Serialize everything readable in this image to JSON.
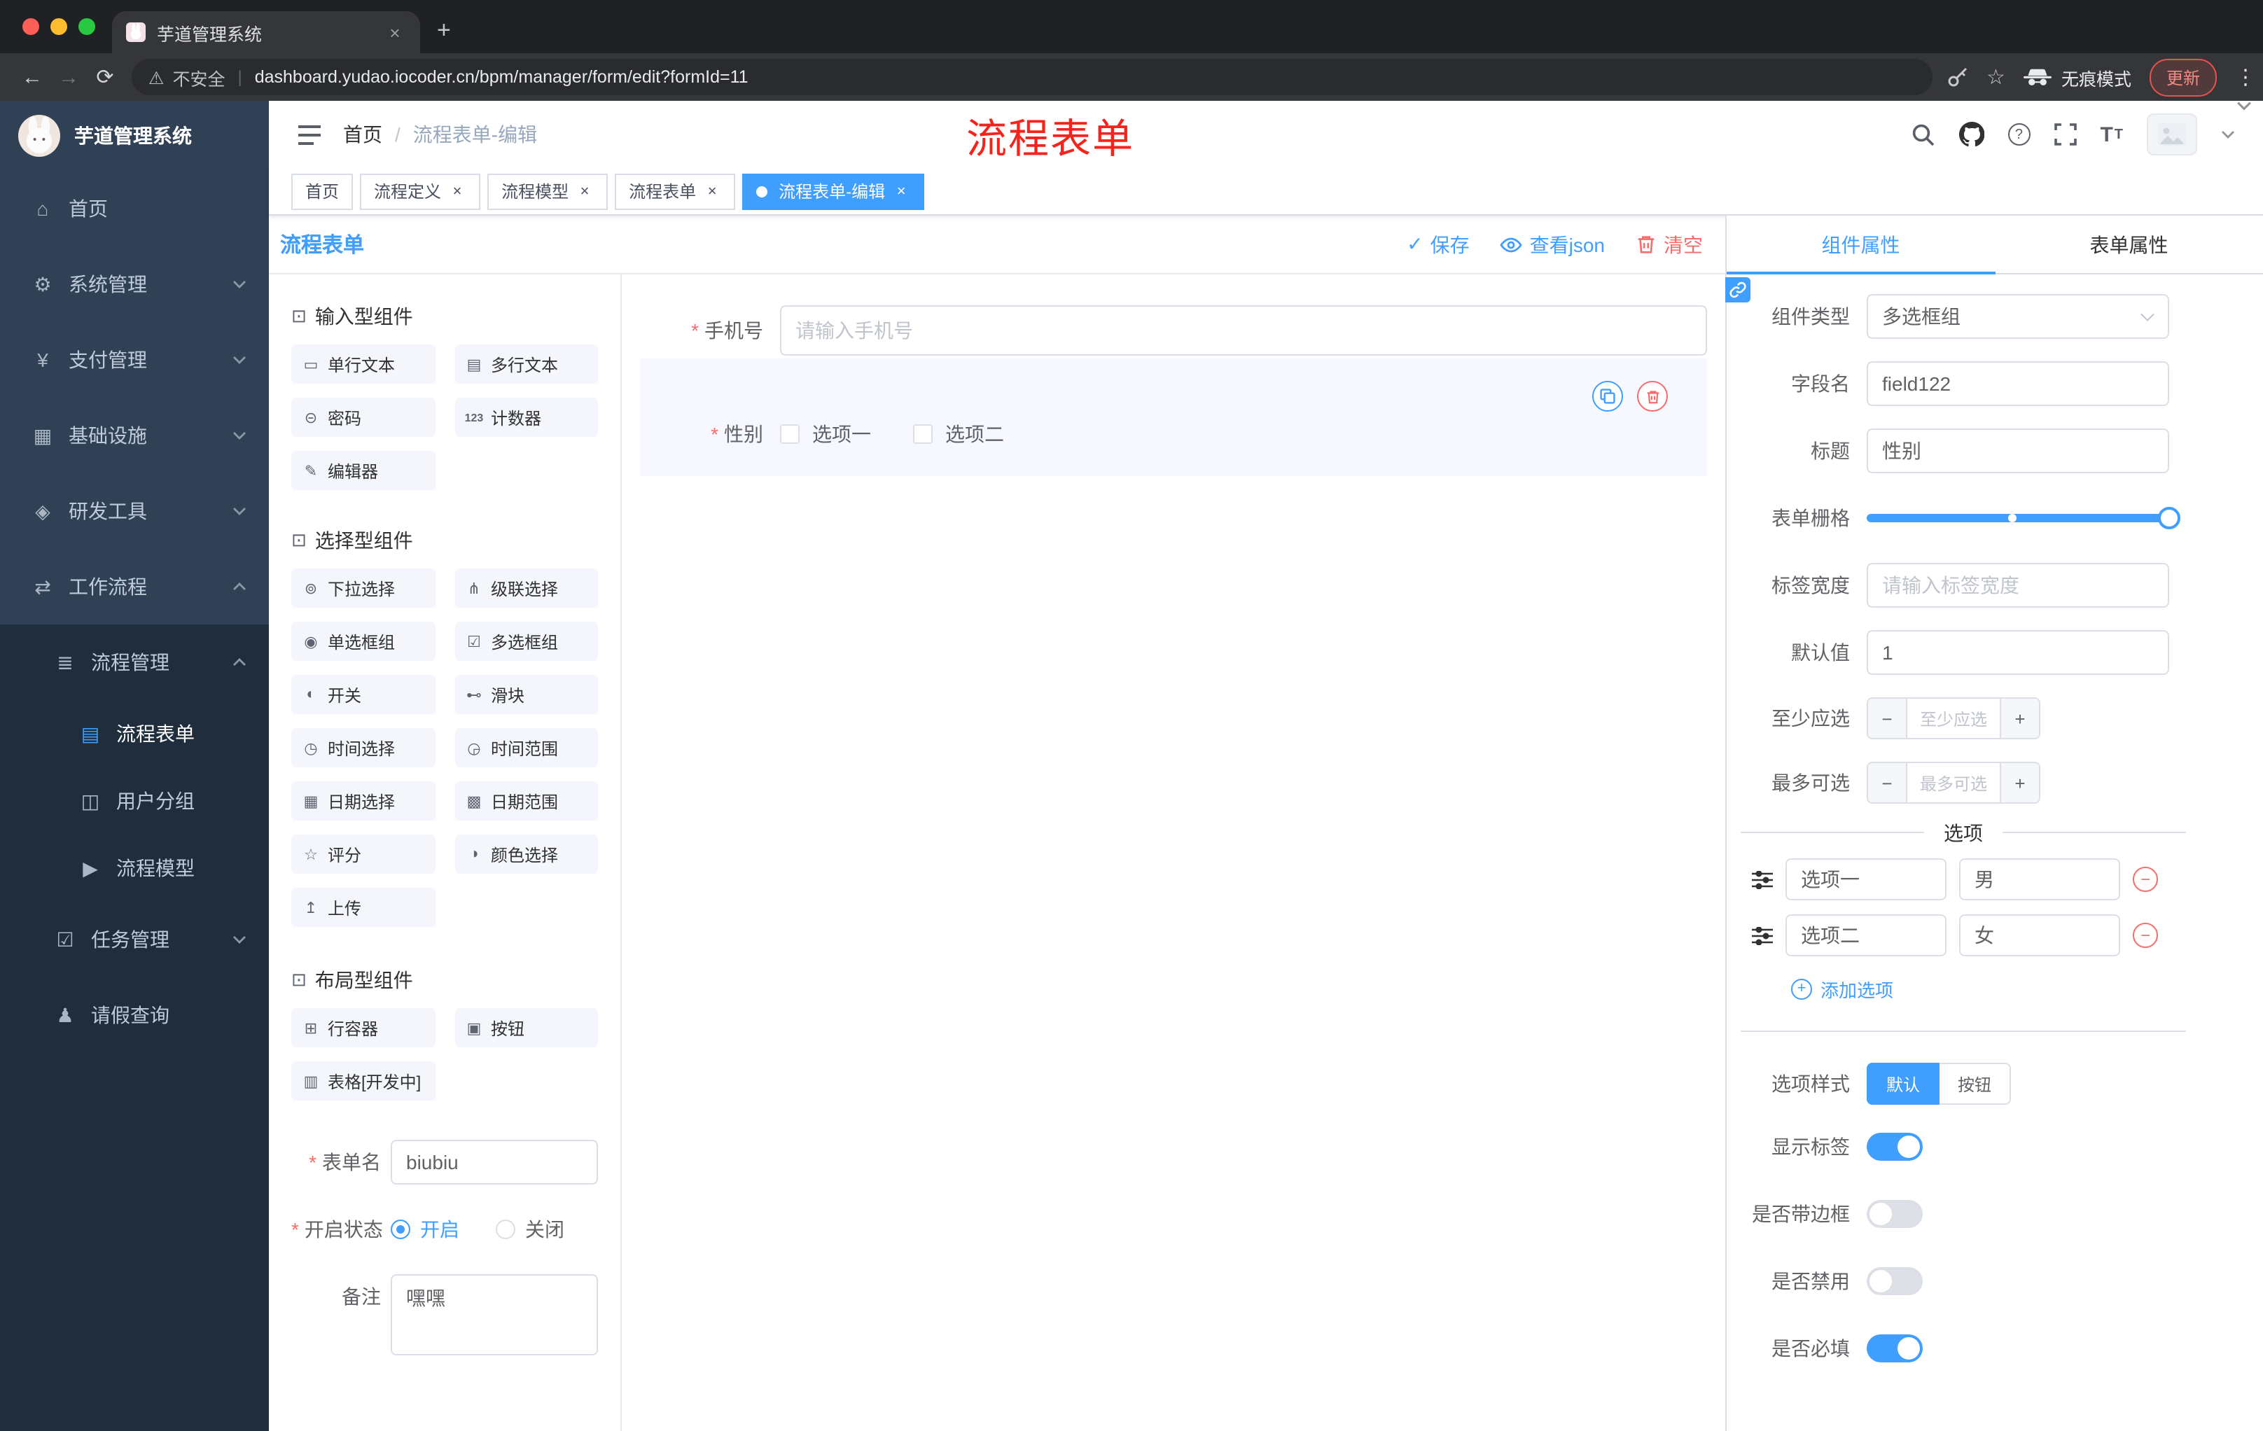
{
  "colors": {
    "accent": "#409eff",
    "danger": "#f56c6c",
    "sidebar_bg": "#304156",
    "submenu_bg": "#1f2d3d"
  },
  "icons": {
    "back-icon": "←",
    "forward-icon": "→",
    "reload-icon": "⟳",
    "warning-icon": "⚠",
    "divider-bar": "|",
    "star-icon": "☆",
    "kebab-icon": "⋮",
    "plus-icon": "+",
    "close-icon": "×",
    "minus-icon": "−",
    "question-icon": "?",
    "breadcrumb-separator": "/",
    "check-icon": "✓",
    "fontsize-icon": "T",
    "home-icon": "⌂",
    "gear-icon": "⚙",
    "pay-icon": "¥",
    "infra-icon": "▦",
    "tools-icon": "◈",
    "workflow-icon": "⇄",
    "process-mgmt-icon": "≣",
    "form-icon": "▤",
    "user-group-icon": "◫",
    "model-icon": "▶",
    "task-icon": "☑",
    "leave-icon": "♟",
    "group-icon": "⊡",
    "single-line-icon": "▭",
    "textarea-icon": "▤",
    "password-icon": "⊝",
    "counter-icon": "123",
    "editor-icon": "✎",
    "select-icon": "⊚",
    "cascader-icon": "⋔",
    "radio-icon": "◉",
    "checkbox-icon": "☑",
    "switch-icon": "◐",
    "slider-icon": "⊷",
    "time-icon": "◷",
    "time-range-icon": "◶",
    "date-icon": "▦",
    "date-range-icon": "▩",
    "rate-icon": "☆",
    "color-icon": "◑",
    "upload-icon": "↥",
    "row-icon": "⊞",
    "button-icon": "▣",
    "table-icon": "▥"
  },
  "browser": {
    "tab_title": "芋道管理系统",
    "security_label": "不安全",
    "url": "dashboard.yudao.iocoder.cn/bpm/manager/form/edit?formId=11",
    "incognito_label": "无痕模式",
    "update_label": "更新"
  },
  "sidebar": {
    "logo_title": "芋道管理系统",
    "top_items": [
      {
        "label": "首页",
        "icon": "home-icon"
      },
      {
        "label": "系统管理",
        "icon": "gear-icon"
      },
      {
        "label": "支付管理",
        "icon": "pay-icon"
      },
      {
        "label": "基础设施",
        "icon": "infra-icon"
      },
      {
        "label": "研发工具",
        "icon": "tools-icon"
      },
      {
        "label": "工作流程",
        "icon": "workflow-icon"
      }
    ],
    "process_group": {
      "label": "流程管理",
      "icon": "process-mgmt-icon"
    },
    "process_children": [
      {
        "label": "流程表单",
        "icon": "form-icon",
        "active": true
      },
      {
        "label": "用户分组",
        "icon": "user-group-icon"
      },
      {
        "label": "流程模型",
        "icon": "model-icon"
      }
    ],
    "task_item": {
      "label": "任务管理",
      "icon": "task-icon"
    },
    "leave_item": {
      "label": "请假查询",
      "icon": "leave-icon"
    }
  },
  "header": {
    "breadcrumb": [
      "首页",
      "流程表单-编辑"
    ],
    "annotation": "流程表单"
  },
  "tags": [
    {
      "label": "首页"
    },
    {
      "label": "流程定义"
    },
    {
      "label": "流程模型"
    },
    {
      "label": "流程表单"
    },
    {
      "label": "流程表单-编辑",
      "active": true
    }
  ],
  "designer": {
    "title": "流程表单",
    "actions": {
      "save": "保存",
      "view_json": "查看json",
      "clear": "清空"
    },
    "groups": [
      {
        "title": "输入型组件",
        "items": [
          {
            "label": "单行文本",
            "icon": "single-line-icon"
          },
          {
            "label": "多行文本",
            "icon": "textarea-icon"
          },
          {
            "label": "密码",
            "icon": "password-icon"
          },
          {
            "label": "计数器",
            "icon": "counter-icon"
          },
          {
            "label": "编辑器",
            "icon": "editor-icon"
          }
        ]
      },
      {
        "title": "选择型组件",
        "items": [
          {
            "label": "下拉选择",
            "icon": "select-icon"
          },
          {
            "label": "级联选择",
            "icon": "cascader-icon"
          },
          {
            "label": "单选框组",
            "icon": "radio-icon"
          },
          {
            "label": "多选框组",
            "icon": "checkbox-icon"
          },
          {
            "label": "开关",
            "icon": "switch-icon"
          },
          {
            "label": "滑块",
            "icon": "slider-icon"
          },
          {
            "label": "时间选择",
            "icon": "time-icon"
          },
          {
            "label": "时间范围",
            "icon": "time-range-icon"
          },
          {
            "label": "日期选择",
            "icon": "date-icon"
          },
          {
            "label": "日期范围",
            "icon": "date-range-icon"
          },
          {
            "label": "评分",
            "icon": "rate-icon"
          },
          {
            "label": "颜色选择",
            "icon": "color-icon"
          },
          {
            "label": "上传",
            "icon": "upload-icon"
          }
        ]
      },
      {
        "title": "布局型组件",
        "items": [
          {
            "label": "行容器",
            "icon": "row-icon"
          },
          {
            "label": "按钮",
            "icon": "button-icon"
          },
          {
            "label": "表格[开发中]",
            "icon": "table-icon"
          }
        ]
      }
    ],
    "meta": {
      "name_label": "表单名",
      "name_value": "biubiu",
      "status_label": "开启状态",
      "status_on": "开启",
      "status_off": "关闭",
      "remark_label": "备注",
      "remark_value": "嘿嘿"
    },
    "canvas": {
      "phone_label": "手机号",
      "phone_placeholder": "请输入手机号",
      "gender_label": "性别",
      "gender_options": [
        "选项一",
        "选项二"
      ]
    }
  },
  "props": {
    "tabs": [
      "组件属性",
      "表单属性"
    ],
    "type_label": "组件类型",
    "type_value": "多选框组",
    "field_label": "字段名",
    "field_value": "field122",
    "title_label": "标题",
    "title_value": "性别",
    "grid_label": "表单栅格",
    "label_width_label": "标签宽度",
    "label_width_placeholder": "请输入标签宽度",
    "default_label": "默认值",
    "default_value": "1",
    "min_label": "至少应选",
    "min_placeholder": "至少应选",
    "max_label": "最多可选",
    "max_placeholder": "最多可选",
    "options_divider": "选项",
    "options": [
      {
        "name": "选项一",
        "value": "男"
      },
      {
        "name": "选项二",
        "value": "女"
      }
    ],
    "add_option": "添加选项",
    "style_label": "选项样式",
    "style_options": [
      "默认",
      "按钮"
    ],
    "style_selected": "默认",
    "toggles": [
      {
        "label": "显示标签",
        "on": true
      },
      {
        "label": "是否带边框",
        "on": false
      },
      {
        "label": "是否禁用",
        "on": false
      },
      {
        "label": "是否必填",
        "on": true
      }
    ]
  }
}
